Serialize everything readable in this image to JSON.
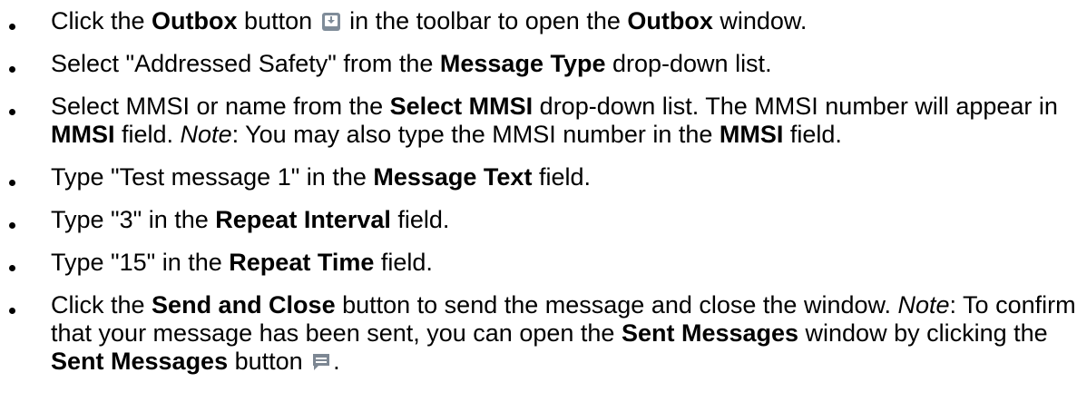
{
  "steps": [
    {
      "t1": "Click the ",
      "b1": "Outbox",
      "t2": " button ",
      "icon": "outbox-icon",
      "t3": " in the toolbar to open the ",
      "b2": "Outbox",
      "t4": " window."
    },
    {
      "t1": "Select \"Addressed Safety\" from the ",
      "b1": "Message Type",
      "t2": " drop-down list."
    },
    {
      "t1": "Select MMSI or name from the ",
      "b1": "Select MMSI",
      "t2": " drop-down list. The MMSI number will appear in ",
      "b2": "MMSI",
      "t3": " field. ",
      "note": "Note",
      "t4": ": You may also type the MMSI number in the ",
      "b3": "MMSI",
      "t5": " field."
    },
    {
      "t1": "Type \"Test message 1\" in the ",
      "b1": "Message Text",
      "t2": " field."
    },
    {
      "t1": "Type \"3\" in the ",
      "b1": "Repeat Interval",
      "t2": " field."
    },
    {
      "t1": "Type \"15\" in the ",
      "b1": "Repeat Time",
      "t2": " field."
    },
    {
      "t1": "Click the ",
      "b1": "Send and Close",
      "t2": " button to send the message and close the window. ",
      "note": "Note",
      "t3": ": To confirm that your message has been sent, you can open the ",
      "b2": "Sent Messages",
      "t4": " window by clicking the ",
      "b3": "Sent Messages",
      "t5": " button ",
      "icon": "sent-messages-icon",
      "t6": "."
    }
  ],
  "colors": {
    "text": "#000000",
    "outbox_icon_fill": "#7f8c99",
    "sent_icon_fill": "#7d8793"
  }
}
